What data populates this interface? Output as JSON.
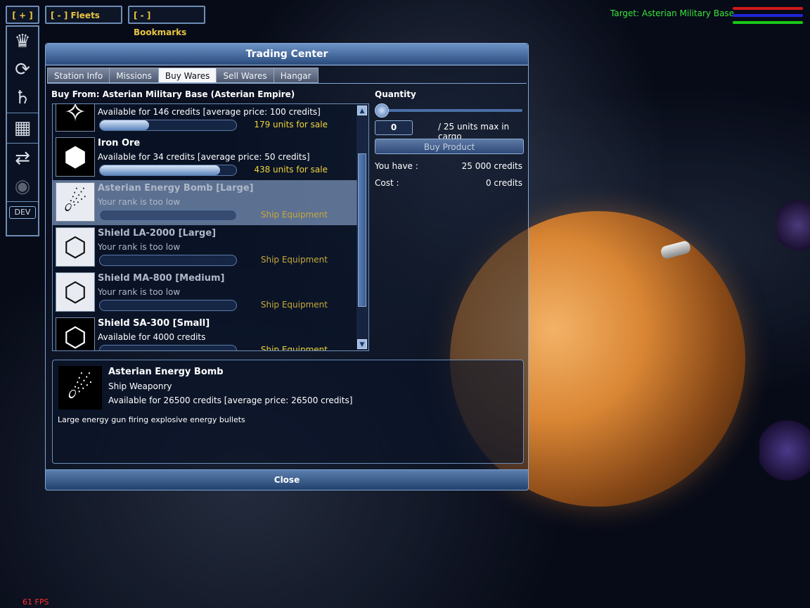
{
  "nav": {
    "plus_label": "[ + ]",
    "fleets_label": "[ - ] Fleets",
    "bookmarks_label": "[ - ] Bookmarks",
    "dev_label": "DEV",
    "sidebar_icons": [
      "crown-icon",
      "cycle-icon",
      "planet-icon",
      "cargo-icon",
      "trade-icon",
      "signal-icon"
    ]
  },
  "target": {
    "label": "Target: Asterian Military Base",
    "bar_colors": [
      "#d01a1a",
      "#2424d8",
      "#18c818"
    ]
  },
  "window": {
    "title": "Trading Center",
    "tabs": [
      {
        "label": "Station Info",
        "active": false
      },
      {
        "label": "Missions",
        "active": false
      },
      {
        "label": "Buy Wares",
        "active": true
      },
      {
        "label": "Sell Wares",
        "active": false
      },
      {
        "label": "Hangar",
        "active": false
      }
    ],
    "buy_from": "Buy From: Asterian Military Base (Asterian Empire)",
    "items": [
      {
        "name": "",
        "desc": "Available for 146 credits [average price: 100 credits]",
        "units": "179 units for sale",
        "stock": 0.36,
        "state": "normal",
        "icon": "crystal-icon"
      },
      {
        "name": "Iron Ore",
        "desc": "Available for 34 credits [average price: 50 credits]",
        "units": "438 units for sale",
        "stock": 0.88,
        "state": "normal",
        "icon": "ore-icon"
      },
      {
        "name": "Asterian Energy Bomb [Large]",
        "desc": "Your rank is too low",
        "units": "Ship Equipment",
        "stock": 0,
        "state": "selected",
        "icon": "energy-bomb-icon"
      },
      {
        "name": "Shield LA-2000 [Large]",
        "desc": "Your rank is too low",
        "units": "Ship Equipment",
        "stock": 0,
        "state": "dim",
        "icon": "shield-icon"
      },
      {
        "name": "Shield MA-800 [Medium]",
        "desc": "Your rank is too low",
        "units": "Ship Equipment",
        "stock": 0,
        "state": "dim",
        "icon": "shield-icon"
      },
      {
        "name": "Shield SA-300 [Small]",
        "desc": "Available for 4000 credits",
        "units": "Ship Equipment",
        "stock": 0,
        "state": "normal",
        "icon": "shield-icon"
      }
    ],
    "quantity": {
      "label": "Quantity",
      "value": "0",
      "max_text": "/ 25 units max in cargo",
      "buy_label": "Buy Product",
      "you_have_label": "You have :",
      "you_have_value": "25 000 credits",
      "cost_label": "Cost :",
      "cost_value": "0 credits"
    },
    "detail": {
      "name": "Asterian Energy Bomb",
      "category": "Ship Weaponry",
      "availability": "Available for 26500 credits [average price: 26500 credits]",
      "description": "Large energy gun firing explosive energy bullets",
      "icon": "energy-bomb-icon"
    },
    "close_label": "Close"
  },
  "fps": "61 FPS"
}
